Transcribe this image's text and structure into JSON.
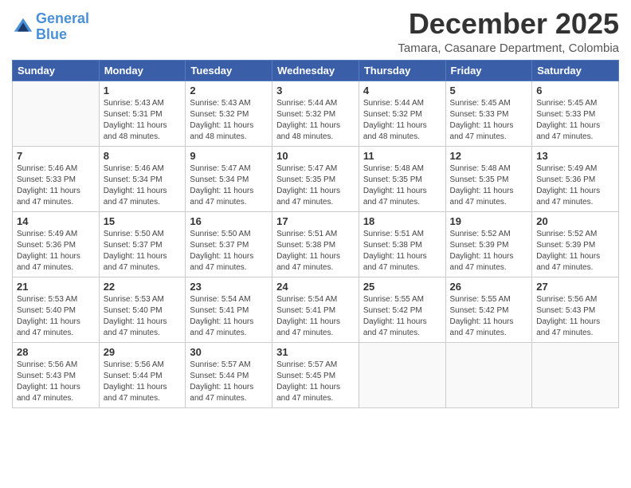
{
  "header": {
    "logo_line1": "General",
    "logo_line2": "Blue",
    "month": "December 2025",
    "location": "Tamara, Casanare Department, Colombia"
  },
  "days_of_week": [
    "Sunday",
    "Monday",
    "Tuesday",
    "Wednesday",
    "Thursday",
    "Friday",
    "Saturday"
  ],
  "weeks": [
    [
      {
        "day": "",
        "info": ""
      },
      {
        "day": "1",
        "info": "Sunrise: 5:43 AM\nSunset: 5:31 PM\nDaylight: 11 hours\nand 48 minutes."
      },
      {
        "day": "2",
        "info": "Sunrise: 5:43 AM\nSunset: 5:32 PM\nDaylight: 11 hours\nand 48 minutes."
      },
      {
        "day": "3",
        "info": "Sunrise: 5:44 AM\nSunset: 5:32 PM\nDaylight: 11 hours\nand 48 minutes."
      },
      {
        "day": "4",
        "info": "Sunrise: 5:44 AM\nSunset: 5:32 PM\nDaylight: 11 hours\nand 48 minutes."
      },
      {
        "day": "5",
        "info": "Sunrise: 5:45 AM\nSunset: 5:33 PM\nDaylight: 11 hours\nand 47 minutes."
      },
      {
        "day": "6",
        "info": "Sunrise: 5:45 AM\nSunset: 5:33 PM\nDaylight: 11 hours\nand 47 minutes."
      }
    ],
    [
      {
        "day": "7",
        "info": "Sunrise: 5:46 AM\nSunset: 5:33 PM\nDaylight: 11 hours\nand 47 minutes."
      },
      {
        "day": "8",
        "info": "Sunrise: 5:46 AM\nSunset: 5:34 PM\nDaylight: 11 hours\nand 47 minutes."
      },
      {
        "day": "9",
        "info": "Sunrise: 5:47 AM\nSunset: 5:34 PM\nDaylight: 11 hours\nand 47 minutes."
      },
      {
        "day": "10",
        "info": "Sunrise: 5:47 AM\nSunset: 5:35 PM\nDaylight: 11 hours\nand 47 minutes."
      },
      {
        "day": "11",
        "info": "Sunrise: 5:48 AM\nSunset: 5:35 PM\nDaylight: 11 hours\nand 47 minutes."
      },
      {
        "day": "12",
        "info": "Sunrise: 5:48 AM\nSunset: 5:35 PM\nDaylight: 11 hours\nand 47 minutes."
      },
      {
        "day": "13",
        "info": "Sunrise: 5:49 AM\nSunset: 5:36 PM\nDaylight: 11 hours\nand 47 minutes."
      }
    ],
    [
      {
        "day": "14",
        "info": "Sunrise: 5:49 AM\nSunset: 5:36 PM\nDaylight: 11 hours\nand 47 minutes."
      },
      {
        "day": "15",
        "info": "Sunrise: 5:50 AM\nSunset: 5:37 PM\nDaylight: 11 hours\nand 47 minutes."
      },
      {
        "day": "16",
        "info": "Sunrise: 5:50 AM\nSunset: 5:37 PM\nDaylight: 11 hours\nand 47 minutes."
      },
      {
        "day": "17",
        "info": "Sunrise: 5:51 AM\nSunset: 5:38 PM\nDaylight: 11 hours\nand 47 minutes."
      },
      {
        "day": "18",
        "info": "Sunrise: 5:51 AM\nSunset: 5:38 PM\nDaylight: 11 hours\nand 47 minutes."
      },
      {
        "day": "19",
        "info": "Sunrise: 5:52 AM\nSunset: 5:39 PM\nDaylight: 11 hours\nand 47 minutes."
      },
      {
        "day": "20",
        "info": "Sunrise: 5:52 AM\nSunset: 5:39 PM\nDaylight: 11 hours\nand 47 minutes."
      }
    ],
    [
      {
        "day": "21",
        "info": "Sunrise: 5:53 AM\nSunset: 5:40 PM\nDaylight: 11 hours\nand 47 minutes."
      },
      {
        "day": "22",
        "info": "Sunrise: 5:53 AM\nSunset: 5:40 PM\nDaylight: 11 hours\nand 47 minutes."
      },
      {
        "day": "23",
        "info": "Sunrise: 5:54 AM\nSunset: 5:41 PM\nDaylight: 11 hours\nand 47 minutes."
      },
      {
        "day": "24",
        "info": "Sunrise: 5:54 AM\nSunset: 5:41 PM\nDaylight: 11 hours\nand 47 minutes."
      },
      {
        "day": "25",
        "info": "Sunrise: 5:55 AM\nSunset: 5:42 PM\nDaylight: 11 hours\nand 47 minutes."
      },
      {
        "day": "26",
        "info": "Sunrise: 5:55 AM\nSunset: 5:42 PM\nDaylight: 11 hours\nand 47 minutes."
      },
      {
        "day": "27",
        "info": "Sunrise: 5:56 AM\nSunset: 5:43 PM\nDaylight: 11 hours\nand 47 minutes."
      }
    ],
    [
      {
        "day": "28",
        "info": "Sunrise: 5:56 AM\nSunset: 5:43 PM\nDaylight: 11 hours\nand 47 minutes."
      },
      {
        "day": "29",
        "info": "Sunrise: 5:56 AM\nSunset: 5:44 PM\nDaylight: 11 hours\nand 47 minutes."
      },
      {
        "day": "30",
        "info": "Sunrise: 5:57 AM\nSunset: 5:44 PM\nDaylight: 11 hours\nand 47 minutes."
      },
      {
        "day": "31",
        "info": "Sunrise: 5:57 AM\nSunset: 5:45 PM\nDaylight: 11 hours\nand 47 minutes."
      },
      {
        "day": "",
        "info": ""
      },
      {
        "day": "",
        "info": ""
      },
      {
        "day": "",
        "info": ""
      }
    ]
  ]
}
